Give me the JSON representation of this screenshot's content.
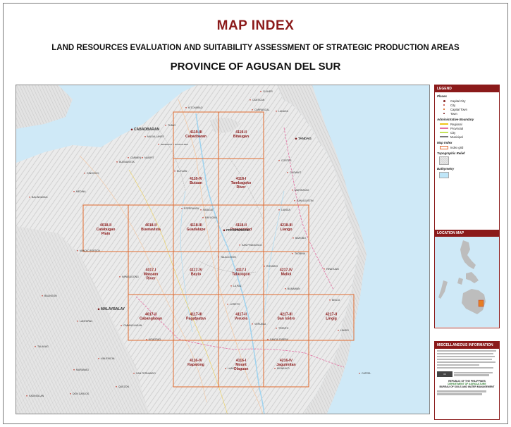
{
  "header": {
    "title": "MAP INDEX",
    "subtitle": "LAND RESOURCES EVALUATION AND SUITABILITY ASSESSMENT OF STRATEGIC PRODUCTION AREAS",
    "province": "PROVINCE OF AGUSAN DEL SUR"
  },
  "map": {
    "colors": {
      "grid": "#e06b2f",
      "tile_label": "#8b1a1a",
      "sea": "#cfe9f7",
      "land": "#e9e9e9"
    },
    "tiles": [
      {
        "code": "4119-III",
        "name": "Cabadbaran"
      },
      {
        "code": "4119-II",
        "name": "Bitaugan"
      },
      {
        "code": "4118-IV",
        "name": "Butuan"
      },
      {
        "code": "4118-I",
        "name": "Tambagoko River"
      },
      {
        "code": "4018-II",
        "name": "Catabugao Plain"
      },
      {
        "code": "4018-II",
        "name": "Buenavista"
      },
      {
        "code": "4118-III",
        "name": "Guadalupe"
      },
      {
        "code": "4118-II",
        "name": "Prosperidad"
      },
      {
        "code": "4218-III",
        "name": "Liango"
      },
      {
        "code": "4017-I",
        "name": "Maasam River"
      },
      {
        "code": "4117-IV",
        "name": "Baylo"
      },
      {
        "code": "4117-I",
        "name": "Talacogon"
      },
      {
        "code": "4217-IV",
        "name": "Maliol"
      },
      {
        "code": "4017-II",
        "name": "Cabanglasan"
      },
      {
        "code": "4117-III",
        "name": "Pagatpatan"
      },
      {
        "code": "4117-II",
        "name": "Veruela"
      },
      {
        "code": "4217-III",
        "name": "San Isidro"
      },
      {
        "code": "4217-II",
        "name": "Lingig"
      },
      {
        "code": "4116-IV",
        "name": "Kapalong"
      },
      {
        "code": "4116-I",
        "name": "Mount Olaguan"
      },
      {
        "code": "4216-IV",
        "name": "Jaguimitan"
      }
    ],
    "place_labels": {
      "cabadbaran_city": "CABADBARAN",
      "tandag": "TANDAG",
      "prosperidad": "PROSPERIDAD",
      "malaybalay": "MALAYBALAY",
      "valencia": "VALENCIA",
      "bislig": "BISLIG",
      "lingig": "LINGIG",
      "la_paz": "LA PAZ",
      "talacogon": "TALACOGON",
      "san_francisco": "SAN FRANCISCO",
      "rosario": "ROSARIO",
      "bunawan": "BUNAWAN",
      "trento": "TRENTO",
      "santa_josefa": "SANTA JOSEFA",
      "veruela": "VERUELA",
      "loreto": "LORETO",
      "esperanza": "ESPERANZA",
      "hinatuan": "HINATUAN",
      "lianga": "LIANGA",
      "barobo": "BAROBO",
      "tagbina": "TAGBINA",
      "sibagat": "SIBAGAT",
      "bayugan": "BAYUGAN",
      "laak": "LAAK",
      "monkayo": "MONKAYO",
      "cateel": "CATEEL",
      "butuan": "BUTUAN",
      "magallanes": "MAGALLANES",
      "buenavista": "BUENAVISTA",
      "nasipit": "NASIPIT",
      "carmen": "CARMEN",
      "tubay": "TUBAY",
      "remedios": "REMEDIOS T. ROMUALDEZ",
      "kitcharao": "KITCHARAO",
      "cantilan": "CANTILAN",
      "carrascal": "CARRASCAL",
      "lanuza": "LANUZA",
      "cortes": "CORTES",
      "cagwait": "CAGWAIT",
      "marihatag": "MARIHATAG",
      "san_agustin": "SAN AGUSTIN",
      "claver": "CLAVER",
      "gingoog": "GINGOOG",
      "medina": "MEDINA",
      "balingasag": "BALINGASAG",
      "impasugong": "IMPASUGONG",
      "quezon": "QUEZON",
      "kitaotao": "KITAOTAO",
      "lantapan": "LANTAPAN",
      "maramag": "MARAMAG",
      "don_carlos": "DON CARLOS",
      "kadingilan": "KADINGILAN",
      "cabanglasan_town": "CABANGLASAN",
      "san_fernando": "SAN FERNANDO",
      "talakag": "TALAKAG",
      "baungon": "BAUNGON",
      "manolo": "MANOLO FORTICH"
    }
  },
  "legend": {
    "title": "LEGEND",
    "places_heading": "Places",
    "places": [
      "Capital City",
      "City",
      "Capital Town",
      "Town"
    ],
    "admin_heading": "Administrative Boundary",
    "admin": [
      {
        "label": "Regional",
        "color": "#f0c419"
      },
      {
        "label": "Provincial",
        "color": "#e36da0"
      },
      {
        "label": "City",
        "color": "#c4e25a"
      },
      {
        "label": "Municipal",
        "color": "#777777"
      }
    ],
    "index_heading": "Map Index",
    "index_label": "Index grid",
    "relief_heading": "Topographic Relief",
    "bathy_heading": "Bathymetry"
  },
  "location_map": {
    "title": "LOCATION MAP"
  },
  "misc": {
    "title": "MISCELLANEOUS INFORMATION",
    "department": {
      "line1": "REPUBLIC OF THE PHILIPPINES",
      "line2": "DEPARTMENT OF AGRICULTURE",
      "line3": "BUREAU OF SOILS AND WATER MANAGEMENT"
    }
  }
}
